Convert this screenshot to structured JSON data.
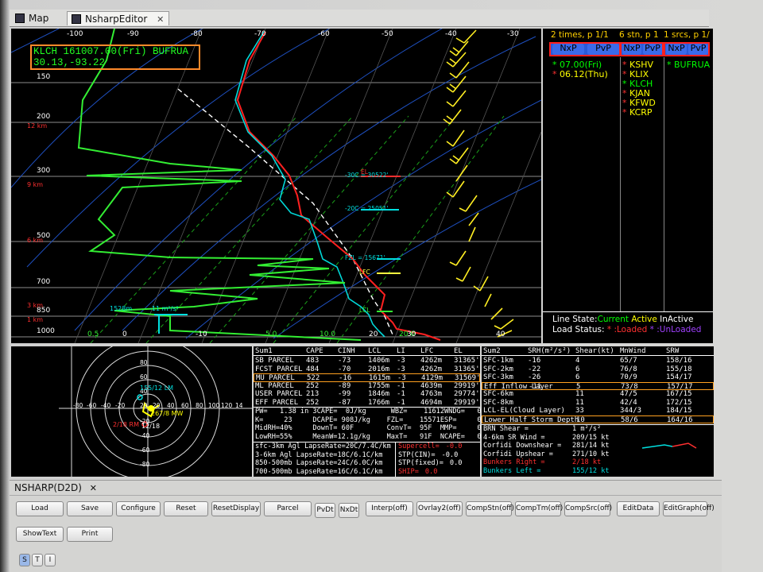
{
  "tabs": [
    {
      "label": "Map"
    },
    {
      "label": "NsharpEditor",
      "close": "✕"
    }
  ],
  "skewt": {
    "station_line1": "KLCH 161007.00(Fri) BUFRUA",
    "station_line2": "30.13,-93.22",
    "temp_ticks": [
      "-100",
      "-90",
      "-80",
      "-70",
      "-60",
      "-50",
      "-40",
      "-30"
    ],
    "pressure_labels": [
      "150",
      "200",
      "300",
      "500",
      "700",
      "850",
      "1000"
    ],
    "height_labels": [
      "12 km",
      "9 km",
      "6 km",
      "3 km",
      "1 km"
    ],
    "bottom_ticks": [
      "-10",
      "0.5",
      "0",
      "5.0",
      "10.0",
      "20.0",
      "20",
      "30",
      "40"
    ],
    "level_labels": [
      "-30C = 30522'",
      "-20C = 25051'",
      "FZL = 15671'",
      "LFC",
      "LCL",
      "EL"
    ],
    "srh_labels": [
      "1528m",
      "-11 m²/s²"
    ]
  },
  "right_panel": {
    "times_title": "2 times, p 1/1",
    "stn_title": "6 stn, p 1",
    "srcs_title": "1 srcs, p 1/",
    "btn_nxp": "NxP",
    "btn_pvp": "PvP",
    "times": [
      {
        "star": "*",
        "text": "07.00(Fri)",
        "color": "#00ff00"
      },
      {
        "star": "*",
        "text": "06.12(Thu)",
        "color": "#ffff00"
      }
    ],
    "stations": [
      "KSHV",
      "KLIX",
      "KLCH",
      "KJAN",
      "KFWD",
      "KCRP"
    ],
    "sources": [
      {
        "star": "*",
        "text": "BUFRUA"
      }
    ],
    "line_state_label": "Line State:",
    "current": "Current",
    "active": "Active",
    "inactive": "InActive",
    "load_status_label": "Load Status:",
    "loaded": "* :Loaded",
    "unloaded": "* :UnLoaded"
  },
  "hodo": {
    "rings": [
      "80",
      "60",
      "40",
      "20",
      "-20",
      "-40",
      "-60",
      "-80"
    ],
    "x_labels": [
      "-80",
      "-60",
      "-40",
      "-20",
      "20",
      "40",
      "60",
      "80",
      "100",
      "120",
      "14"
    ],
    "labels": [
      "155/12 LM",
      "267/8 MW",
      "2/18 RM",
      "12/18"
    ]
  },
  "parcels": {
    "headers": [
      "Sum1",
      "CAPE",
      "CINH",
      "LCL",
      "LI",
      "LFC",
      "EL"
    ],
    "rows": [
      [
        "SB PARCEL",
        "483",
        "-73",
        "1406m",
        "-3",
        "4262m",
        "31365'"
      ],
      [
        "FCST PARCEL",
        "484",
        "-70",
        "2016m",
        "-3",
        "4262m",
        "31365'"
      ],
      [
        "MU PARCEL",
        "522",
        "-16",
        "1615m",
        "-3",
        "4129m",
        "31569'"
      ],
      [
        "ML PARCEL",
        "252",
        "-89",
        "1755m",
        "-1",
        "4639m",
        "29919'"
      ],
      [
        "USER PARCEL",
        "213",
        "-99",
        "1846m",
        "-1",
        "4763m",
        "29774'"
      ],
      [
        "EFF PARCEL",
        "252",
        "-87",
        "1766m",
        "-1",
        "4694m",
        "29919'"
      ]
    ],
    "thermo": [
      "PW=   1.38 in 3CAPE=  0J/kg      WBZ=    11612WNDG=   0.00",
      "K=     23     DCAPE= 908J/kg    FZL=    15571ESP=     0.00",
      "MidRH=40%     DownT= 60F        ConvT=  95F  MMP=     0.04",
      "LowRH=55%     MeanW=12.1g/kg    MaxT=   91F  NCAPE=   0.09"
    ],
    "lapse": [
      "sfc-3km Agl LapseRate=20C/7.4C/km",
      "3-6km Agl LapseRate=18C/6.1C/km",
      "850-500mb LapseRate=24C/6.0C/km",
      "700-500mb LapseRate=16C/6.1C/km"
    ],
    "stp": [
      {
        "label": "Supercell=",
        "value": "-0.0",
        "color": "#ff3030"
      },
      {
        "label": "STP(CIN)=",
        "value": "-0.0",
        "color": "#ffffff"
      },
      {
        "label": "STP(fixed)=",
        "value": "0.0",
        "color": "#ffffff"
      },
      {
        "label": "SHIP=",
        "value": "0.0",
        "color": "#ff3030"
      }
    ]
  },
  "kinematics": {
    "headers": [
      "Sum2",
      "SRH(m²/s²)",
      "Shear(kt)",
      "MnWind",
      "SRW"
    ],
    "rows": [
      [
        "SFC-1km",
        "-16",
        "4",
        "65/7",
        "158/16"
      ],
      [
        "SFC-2km",
        "-22",
        "6",
        "76/8",
        "155/18"
      ],
      [
        "SFC-3km",
        "-26",
        "6",
        "70/9",
        "154/17"
      ],
      [
        "Eff Inflow Layer",
        "-11",
        "5",
        "73/8",
        "157/17"
      ],
      [
        "SFC-6km",
        "",
        "11",
        "47/5",
        "167/15"
      ],
      [
        "SFC-8km",
        "",
        "11",
        "42/4",
        "172/15"
      ],
      [
        "LCL-EL(Cloud Layer)",
        "",
        "33",
        "344/3",
        "184/15"
      ],
      [
        "Lower Half Storm Depth",
        "",
        "10",
        "58/6",
        "164/16"
      ]
    ],
    "extra": [
      {
        "label": "BRN Shear =",
        "value": "1 m²/s²",
        "color": "#ffffff"
      },
      {
        "label": "4-6km SR Wind =",
        "value": "209/15 kt",
        "color": "#ffffff"
      },
      {
        "label": "Corfidi Downshear =",
        "value": "281/14 kt",
        "color": "#ffffff"
      },
      {
        "label": "Corfidi Upshear =",
        "value": "271/10 kt",
        "color": "#ffffff"
      },
      {
        "label": "Bunkers Right =",
        "value": "2/18 kt",
        "color": "#ff3030"
      },
      {
        "label": "Bunkers Left =",
        "value": "155/12 kt",
        "color": "#00e0e0"
      }
    ]
  },
  "bottom": {
    "title": "NSHARP(D2D)",
    "close": "✕",
    "row1": [
      "Load",
      "Save",
      "Configure",
      "Reset",
      "ResetDisplay",
      "Parcel",
      "PvDt",
      "NxDt",
      "Interp(off)",
      "Ovrlay2(off)",
      "CompStn(off)",
      "CompTm(off)",
      "CompSrc(off)",
      "EditData",
      "EditGraph(off)"
    ],
    "row2": [
      "ShowText",
      "Print"
    ],
    "small": [
      "S",
      "T",
      "I"
    ]
  }
}
